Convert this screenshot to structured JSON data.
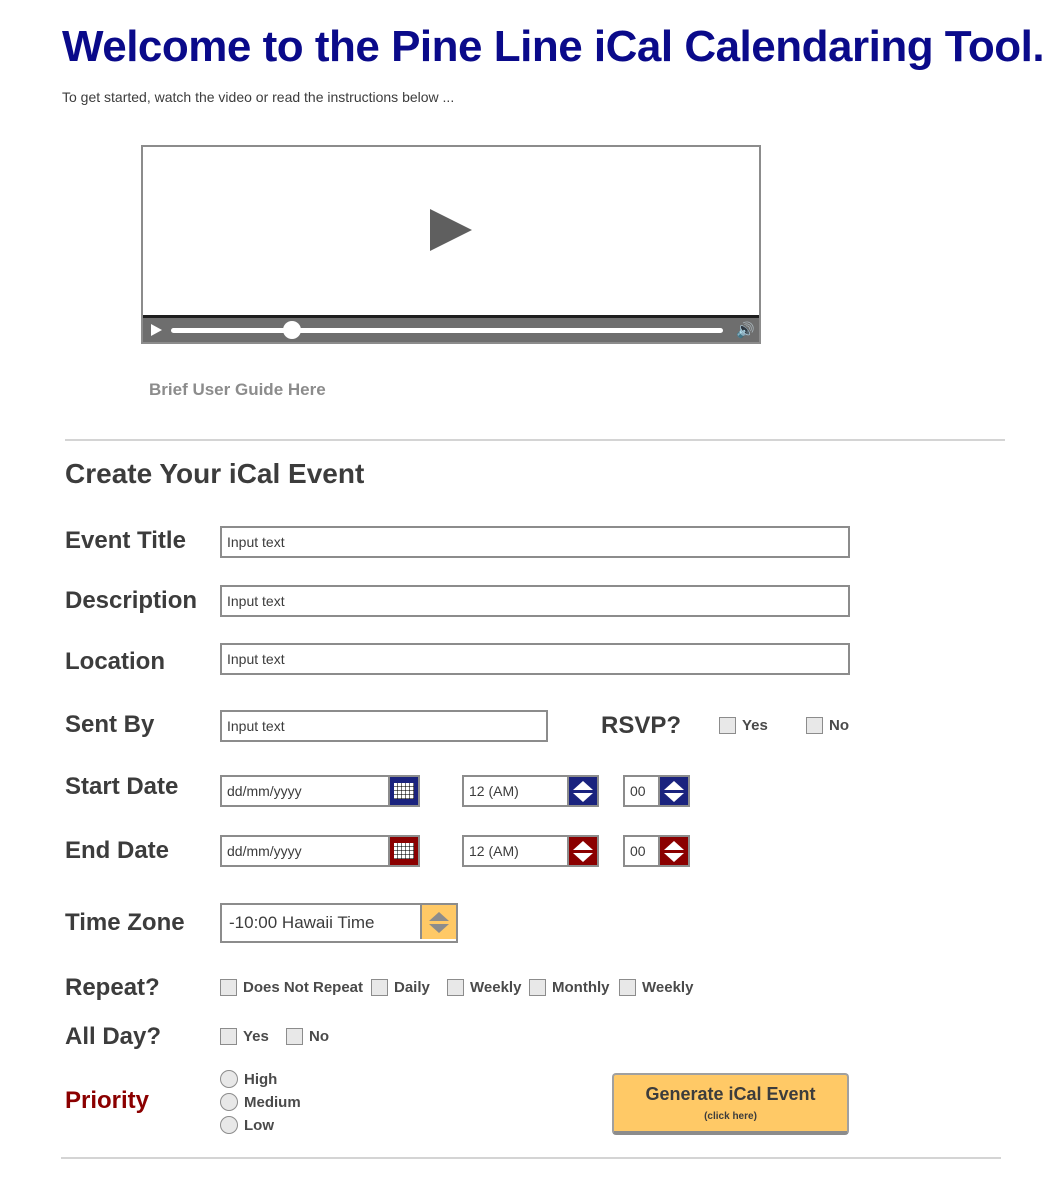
{
  "header": {
    "title": "Welcome to the Pine Line iCal Calendaring Tool.",
    "subtitle": "To get started, watch the video or read the instructions below ..."
  },
  "video": {
    "progress": 0.22,
    "icons": [
      "play-icon",
      "volume-icon"
    ]
  },
  "guide_link": "Brief User Guide Here",
  "form": {
    "heading": "Create Your iCal Event",
    "event_title": {
      "label": "Event Title",
      "placeholder": "Input text"
    },
    "description": {
      "label": "Description",
      "placeholder": "Input text"
    },
    "location": {
      "label": "Location",
      "placeholder": "Input text"
    },
    "sent_by": {
      "label": "Sent By",
      "placeholder": "Input text"
    },
    "rsvp": {
      "label": "RSVP?",
      "options": [
        "Yes",
        "No"
      ]
    },
    "start_date": {
      "label": "Start Date",
      "date": "dd/mm/yyyy",
      "hour": "12 (AM)",
      "minute": "00",
      "accent": "#1a237e"
    },
    "end_date": {
      "label": "End Date",
      "date": "dd/mm/yyyy",
      "hour": "12 (AM)",
      "minute": "00",
      "accent": "#8b0000"
    },
    "time_zone": {
      "label": "Time Zone",
      "value": "-10:00 Hawaii Time"
    },
    "repeat": {
      "label": "Repeat?",
      "options": [
        "Does Not Repeat",
        "Daily",
        "Weekly",
        "Monthly",
        "Weekly"
      ]
    },
    "all_day": {
      "label": "All Day?",
      "options": [
        "Yes",
        "No"
      ]
    },
    "priority": {
      "label": "Priority",
      "options": [
        "High",
        "Medium",
        "Low"
      ]
    },
    "submit": {
      "label": "Generate iCal Event",
      "sub": "(click here)"
    }
  },
  "colors": {
    "title": "#0a0a8a",
    "priority": "#8b0000",
    "button": "#ffc966"
  }
}
